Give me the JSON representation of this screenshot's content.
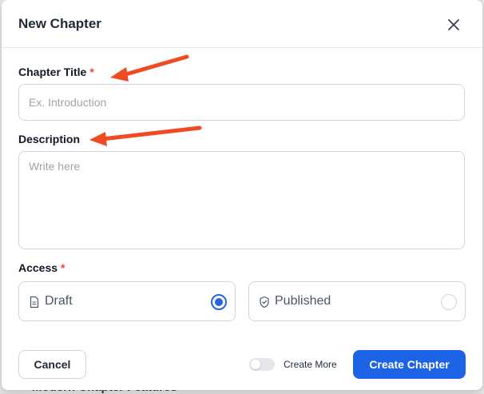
{
  "background": {
    "text": "Modern Chapter Features"
  },
  "dialog": {
    "title": "New Chapter",
    "fields": {
      "chapter_title": {
        "label": "Chapter Title",
        "required_mark": "*",
        "placeholder": "Ex. Introduction",
        "value": ""
      },
      "description": {
        "label": "Description",
        "placeholder": "Write here",
        "value": ""
      },
      "access": {
        "label": "Access",
        "required_mark": "*",
        "options": [
          {
            "label": "Draft",
            "icon": "document-icon",
            "selected": true
          },
          {
            "label": "Published",
            "icon": "shield-check-icon",
            "selected": false
          }
        ]
      }
    },
    "footer": {
      "cancel_label": "Cancel",
      "toggle_label": "Create More",
      "toggle_on": false,
      "submit_label": "Create Chapter"
    }
  },
  "annotations": {
    "arrow_color": "#f04a23"
  },
  "colors": {
    "primary": "#1d63e6",
    "required": "#ef4444"
  }
}
